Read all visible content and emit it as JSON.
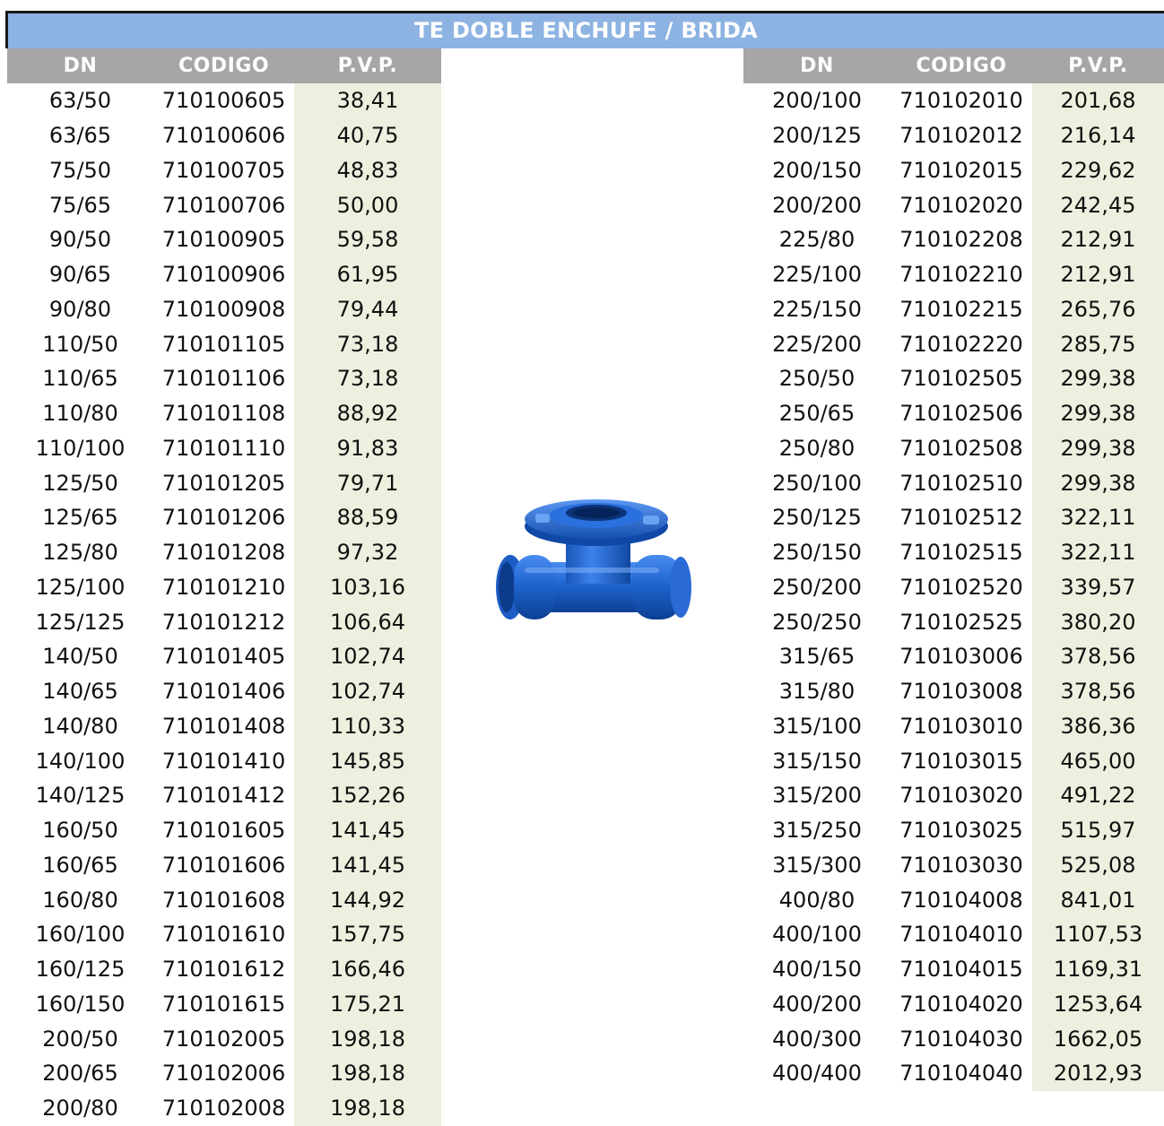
{
  "title": "TE DOBLE ENCHUFE / BRIDA",
  "headers": {
    "dn": "DN",
    "codigo": "CODIGO",
    "pvp": "P.V.P."
  },
  "image": {
    "subject": "ductile-iron-double-socket-flanged-tee-icon",
    "color": "#1f64d0"
  },
  "colors": {
    "title_bg": "#8db3e2",
    "header_bg": "#a6a6a6",
    "price_bg": "#ebf1de"
  },
  "left_rows": [
    {
      "dn": "63/50",
      "codigo": "710100605",
      "pvp": "38,41"
    },
    {
      "dn": "63/65",
      "codigo": "710100606",
      "pvp": "40,75"
    },
    {
      "dn": "75/50",
      "codigo": "710100705",
      "pvp": "48,83"
    },
    {
      "dn": "75/65",
      "codigo": "710100706",
      "pvp": "50,00"
    },
    {
      "dn": "90/50",
      "codigo": "710100905",
      "pvp": "59,58"
    },
    {
      "dn": "90/65",
      "codigo": "710100906",
      "pvp": "61,95"
    },
    {
      "dn": "90/80",
      "codigo": "710100908",
      "pvp": "79,44"
    },
    {
      "dn": "110/50",
      "codigo": "710101105",
      "pvp": "73,18"
    },
    {
      "dn": "110/65",
      "codigo": "710101106",
      "pvp": "73,18"
    },
    {
      "dn": "110/80",
      "codigo": "710101108",
      "pvp": "88,92"
    },
    {
      "dn": "110/100",
      "codigo": "710101110",
      "pvp": "91,83"
    },
    {
      "dn": "125/50",
      "codigo": "710101205",
      "pvp": "79,71"
    },
    {
      "dn": "125/65",
      "codigo": "710101206",
      "pvp": "88,59"
    },
    {
      "dn": "125/80",
      "codigo": "710101208",
      "pvp": "97,32"
    },
    {
      "dn": "125/100",
      "codigo": "710101210",
      "pvp": "103,16"
    },
    {
      "dn": "125/125",
      "codigo": "710101212",
      "pvp": "106,64"
    },
    {
      "dn": "140/50",
      "codigo": "710101405",
      "pvp": "102,74"
    },
    {
      "dn": "140/65",
      "codigo": "710101406",
      "pvp": "102,74"
    },
    {
      "dn": "140/80",
      "codigo": "710101408",
      "pvp": "110,33"
    },
    {
      "dn": "140/100",
      "codigo": "710101410",
      "pvp": "145,85"
    },
    {
      "dn": "140/125",
      "codigo": "710101412",
      "pvp": "152,26"
    },
    {
      "dn": "160/50",
      "codigo": "710101605",
      "pvp": "141,45"
    },
    {
      "dn": "160/65",
      "codigo": "710101606",
      "pvp": "141,45"
    },
    {
      "dn": "160/80",
      "codigo": "710101608",
      "pvp": "144,92"
    },
    {
      "dn": "160/100",
      "codigo": "710101610",
      "pvp": "157,75"
    },
    {
      "dn": "160/125",
      "codigo": "710101612",
      "pvp": "166,46"
    },
    {
      "dn": "160/150",
      "codigo": "710101615",
      "pvp": "175,21"
    },
    {
      "dn": "200/50",
      "codigo": "710102005",
      "pvp": "198,18"
    },
    {
      "dn": "200/65",
      "codigo": "710102006",
      "pvp": "198,18"
    },
    {
      "dn": "200/80",
      "codigo": "710102008",
      "pvp": "198,18"
    }
  ],
  "right_rows": [
    {
      "dn": "200/100",
      "codigo": "710102010",
      "pvp": "201,68"
    },
    {
      "dn": "200/125",
      "codigo": "710102012",
      "pvp": "216,14"
    },
    {
      "dn": "200/150",
      "codigo": "710102015",
      "pvp": "229,62"
    },
    {
      "dn": "200/200",
      "codigo": "710102020",
      "pvp": "242,45"
    },
    {
      "dn": "225/80",
      "codigo": "710102208",
      "pvp": "212,91"
    },
    {
      "dn": "225/100",
      "codigo": "710102210",
      "pvp": "212,91"
    },
    {
      "dn": "225/150",
      "codigo": "710102215",
      "pvp": "265,76"
    },
    {
      "dn": "225/200",
      "codigo": "710102220",
      "pvp": "285,75"
    },
    {
      "dn": "250/50",
      "codigo": "710102505",
      "pvp": "299,38"
    },
    {
      "dn": "250/65",
      "codigo": "710102506",
      "pvp": "299,38"
    },
    {
      "dn": "250/80",
      "codigo": "710102508",
      "pvp": "299,38"
    },
    {
      "dn": "250/100",
      "codigo": "710102510",
      "pvp": "299,38"
    },
    {
      "dn": "250/125",
      "codigo": "710102512",
      "pvp": "322,11"
    },
    {
      "dn": "250/150",
      "codigo": "710102515",
      "pvp": "322,11"
    },
    {
      "dn": "250/200",
      "codigo": "710102520",
      "pvp": "339,57"
    },
    {
      "dn": "250/250",
      "codigo": "710102525",
      "pvp": "380,20"
    },
    {
      "dn": "315/65",
      "codigo": "710103006",
      "pvp": "378,56"
    },
    {
      "dn": "315/80",
      "codigo": "710103008",
      "pvp": "378,56"
    },
    {
      "dn": "315/100",
      "codigo": "710103010",
      "pvp": "386,36"
    },
    {
      "dn": "315/150",
      "codigo": "710103015",
      "pvp": "465,00"
    },
    {
      "dn": "315/200",
      "codigo": "710103020",
      "pvp": "491,22"
    },
    {
      "dn": "315/250",
      "codigo": "710103025",
      "pvp": "515,97"
    },
    {
      "dn": "315/300",
      "codigo": "710103030",
      "pvp": "525,08"
    },
    {
      "dn": "400/80",
      "codigo": "710104008",
      "pvp": "841,01"
    },
    {
      "dn": "400/100",
      "codigo": "710104010",
      "pvp": "1107,53"
    },
    {
      "dn": "400/150",
      "codigo": "710104015",
      "pvp": "1169,31"
    },
    {
      "dn": "400/200",
      "codigo": "710104020",
      "pvp": "1253,64"
    },
    {
      "dn": "400/300",
      "codigo": "710104030",
      "pvp": "1662,05"
    },
    {
      "dn": "400/400",
      "codigo": "710104040",
      "pvp": "2012,93"
    }
  ]
}
